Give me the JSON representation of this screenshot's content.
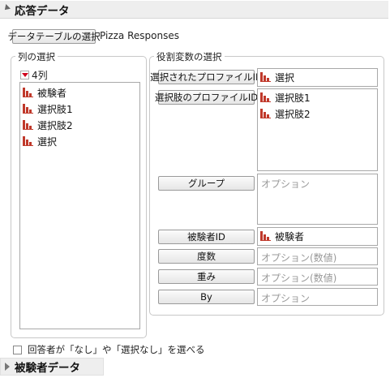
{
  "response_section": {
    "title": "応答データ"
  },
  "data_table": {
    "button_label": "データテーブルの選択",
    "table_name": "Pizza Responses"
  },
  "select_columns": {
    "label": "列の選択",
    "count_label": "4列",
    "columns": [
      "被験者",
      "選択肢1",
      "選択肢2",
      "選択"
    ]
  },
  "cast_roles": {
    "label": "役割変数の選択",
    "roles": {
      "chosen_profile_id": {
        "button": "選択されたプロファイルID",
        "items": [
          "選択"
        ]
      },
      "choice_profile_id": {
        "button": "選択肢のプロファイルID",
        "items": [
          "選択肢1",
          "選択肢2"
        ]
      },
      "grouping": {
        "button": "グループ",
        "placeholder": "オプション"
      },
      "subject_id": {
        "button": "被験者ID",
        "items": [
          "被験者"
        ]
      },
      "freq": {
        "button": "度数",
        "placeholder": "オプション(数値)"
      },
      "weight": {
        "button": "重み",
        "placeholder": "オプション(数値)"
      },
      "by": {
        "button": "By",
        "placeholder": "オプション"
      }
    }
  },
  "none_option": {
    "label": "回答者が「なし」や「選択なし」を選べる",
    "checked": false
  },
  "subject_section": {
    "title": "被験者データ"
  },
  "icons": {
    "column": "nominal-bar-chart-icon",
    "disclosure_open": "triangle-open-icon",
    "disclosure_closed": "triangle-closed-icon"
  },
  "colors": {
    "column_icon": "#c0392b",
    "red_triangle": "#d0021b"
  }
}
